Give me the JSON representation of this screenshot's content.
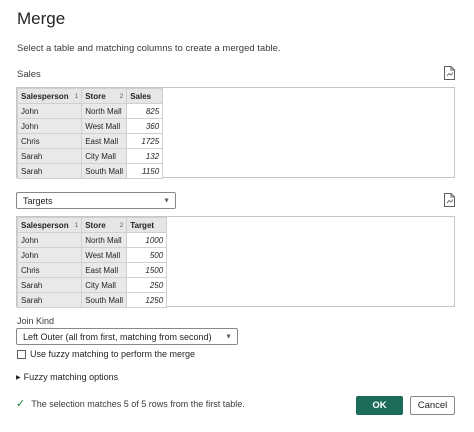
{
  "dialog": {
    "title": "Merge",
    "subtitle": "Select a table and matching columns to create a merged table."
  },
  "first_table": {
    "label": "Sales",
    "columns": [
      {
        "name": "Salesperson",
        "key": "1"
      },
      {
        "name": "Store",
        "key": "2"
      },
      {
        "name": "Sales",
        "key": ""
      }
    ],
    "rows": [
      [
        "John",
        "North Mall",
        "825"
      ],
      [
        "John",
        "West Mall",
        "360"
      ],
      [
        "Chris",
        "East Mall",
        "1725"
      ],
      [
        "Sarah",
        "City Mall",
        "132"
      ],
      [
        "Sarah",
        "South Mall",
        "1150"
      ]
    ]
  },
  "second_table": {
    "selected": "Targets",
    "columns": [
      {
        "name": "Salesperson",
        "key": "1"
      },
      {
        "name": "Store",
        "key": "2"
      },
      {
        "name": "Target",
        "key": ""
      }
    ],
    "rows": [
      [
        "John",
        "North Mall",
        "1000"
      ],
      [
        "John",
        "West Mall",
        "500"
      ],
      [
        "Chris",
        "East Mall",
        "1500"
      ],
      [
        "Sarah",
        "City Mall",
        "250"
      ],
      [
        "Sarah",
        "South Mall",
        "1250"
      ]
    ]
  },
  "join_kind": {
    "label": "Join Kind",
    "selected": "Left Outer (all from first, matching from second)"
  },
  "fuzzy": {
    "checkbox_label": "Use fuzzy matching to perform the merge",
    "checked": false,
    "options_label": "Fuzzy matching options"
  },
  "status": {
    "text": "The selection matches 5 of 5 rows from the first table."
  },
  "buttons": {
    "ok": "OK",
    "cancel": "Cancel"
  },
  "icons": {
    "preview": "file-preview-icon",
    "chevron": "chevron-down-icon",
    "expand": "caret-right-icon",
    "check": "checkmark-icon"
  },
  "colors": {
    "ok_button": "#1d6b5a",
    "check": "#1e7e34",
    "header_bg": "#e6e6e6"
  }
}
